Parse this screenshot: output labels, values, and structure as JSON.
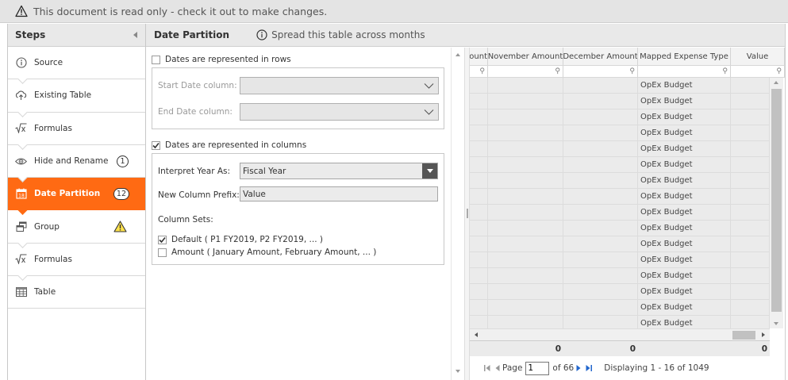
{
  "banner": {
    "message": "This document is read only - check it out to make changes.",
    "icon": "warning-triangle-icon"
  },
  "steps": {
    "title": "Steps",
    "items": [
      {
        "label": "Source",
        "icon": "info-circle-icon",
        "badge": "",
        "active": false
      },
      {
        "label": "Existing Table",
        "icon": "upload-cloud-icon",
        "badge": "",
        "active": false
      },
      {
        "label": "Formulas",
        "icon": "sqrt-x-icon",
        "badge": "",
        "active": false
      },
      {
        "label": "Hide and Rename",
        "icon": "eye-icon",
        "badge": "1",
        "active": false
      },
      {
        "label": "Date Partition",
        "icon": "calendar-icon",
        "badge": "12",
        "active": true
      },
      {
        "label": "Group",
        "icon": "group-windows-icon",
        "badge": "warning",
        "active": false
      },
      {
        "label": "Formulas",
        "icon": "sqrt-x-icon",
        "badge": "",
        "active": false
      },
      {
        "label": "Table",
        "icon": "table-grid-icon",
        "badge": "",
        "active": false
      }
    ]
  },
  "main": {
    "title": "Date Partition",
    "description": "Spread this table across months"
  },
  "options": {
    "rows_checkbox": {
      "label": "Dates are represented in rows",
      "checked": false
    },
    "start_date_label": "Start Date column:",
    "end_date_label": "End Date column:",
    "columns_checkbox": {
      "label": "Dates are represented in columns",
      "checked": true
    },
    "interpret_year_label": "Interpret Year As:",
    "interpret_year_value": "Fiscal Year",
    "prefix_label": "New Column Prefix:",
    "prefix_value": "Value",
    "column_sets_label": "Column Sets:",
    "column_sets": [
      {
        "label": "Default ( P1 FY2019, P2 FY2019, ... )",
        "checked": true
      },
      {
        "label": "Amount ( January Amount, February Amount, ... )",
        "checked": false
      }
    ]
  },
  "grid": {
    "columns": [
      "ount",
      "November Amount",
      "December Amount",
      "Mapped Expense Type",
      "Value"
    ],
    "rows": [
      [
        "",
        "",
        "",
        "OpEx Budget",
        ""
      ],
      [
        "",
        "",
        "",
        "OpEx Budget",
        ""
      ],
      [
        "",
        "",
        "",
        "OpEx Budget",
        ""
      ],
      [
        "",
        "",
        "",
        "OpEx Budget",
        ""
      ],
      [
        "",
        "",
        "",
        "OpEx Budget",
        ""
      ],
      [
        "",
        "",
        "",
        "OpEx Budget",
        ""
      ],
      [
        "",
        "",
        "",
        "OpEx Budget",
        ""
      ],
      [
        "",
        "",
        "",
        "OpEx Budget",
        ""
      ],
      [
        "",
        "",
        "",
        "OpEx Budget",
        ""
      ],
      [
        "",
        "",
        "",
        "OpEx Budget",
        ""
      ],
      [
        "",
        "",
        "",
        "OpEx Budget",
        ""
      ],
      [
        "",
        "",
        "",
        "OpEx Budget",
        ""
      ],
      [
        "",
        "",
        "",
        "OpEx Budget",
        ""
      ],
      [
        "",
        "",
        "",
        "OpEx Budget",
        ""
      ],
      [
        "",
        "",
        "",
        "OpEx Budget",
        ""
      ],
      [
        "",
        "",
        "",
        "OpEx Budget",
        ""
      ]
    ],
    "totals": [
      "",
      "0",
      "0",
      "",
      "0"
    ],
    "pager": {
      "page_label": "Page",
      "page_value": "1",
      "of_label": "of 66",
      "display_text": "Displaying 1 - 16 of 1049"
    }
  },
  "colors": {
    "accent": "#ff6a13",
    "banner_bg": "#e4e4e4",
    "header_bg": "#e9e9e9",
    "grid_bg": "#ebebeb"
  }
}
